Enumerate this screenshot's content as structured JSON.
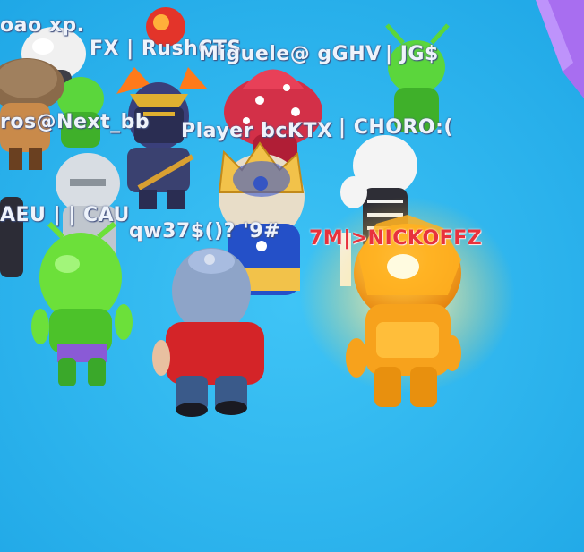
{
  "nametags": [
    {
      "text": "oao xp."
    },
    {
      "text": "FX | RushCTS"
    },
    {
      "text": "Miguele@ gGHV"
    },
    {
      "text": "| JG$"
    },
    {
      "text": "ros@Next_bb"
    },
    {
      "text": "Player bcKTX"
    },
    {
      "text": "| CHORO:("
    },
    {
      "text": "AEU | | CAU"
    },
    {
      "text": "qw37$()? '9#"
    },
    {
      "text": "7M|>NICKOFFZ"
    }
  ],
  "colors": {
    "floor": "#29b6f0",
    "wall": "#a86ef0",
    "nametag": "#eef3fb",
    "highlight_nametag": "#e8323c",
    "golden_player": "#f7a21c"
  }
}
